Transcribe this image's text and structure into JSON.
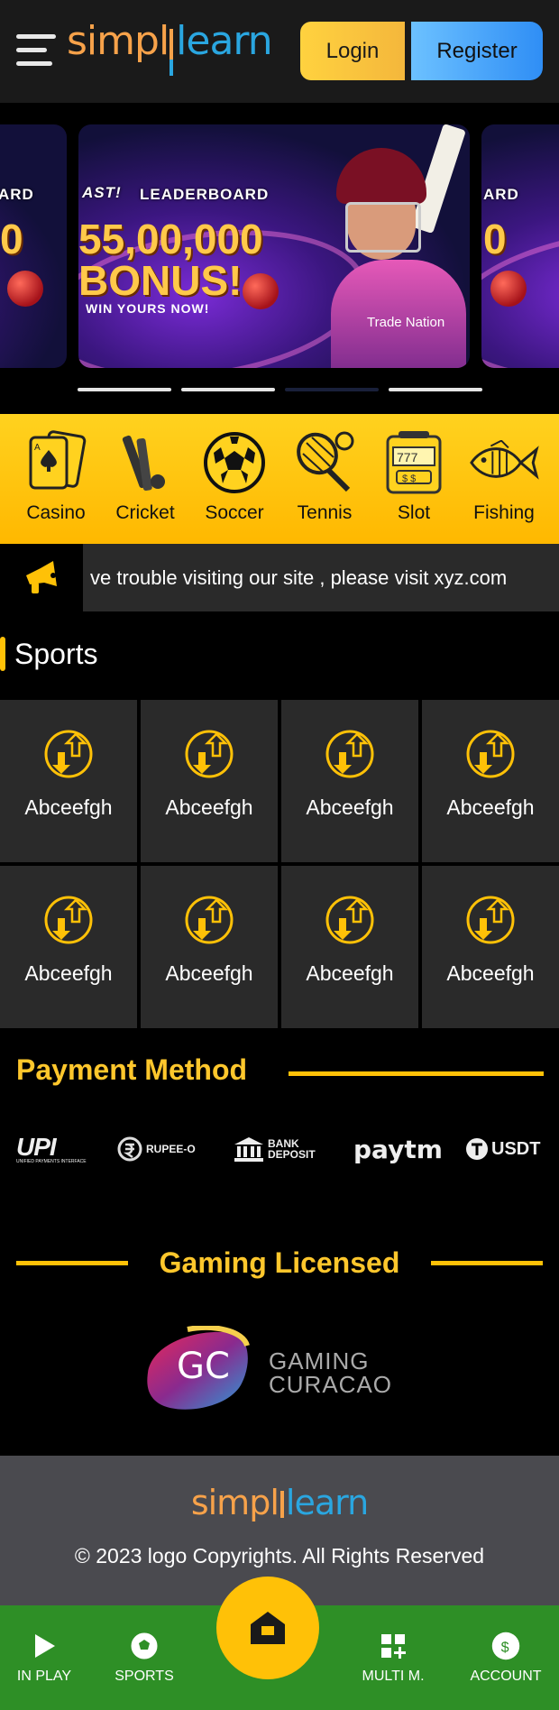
{
  "header": {
    "logo_left": "simpl",
    "logo_right": "learn",
    "login_label": "Login",
    "register_label": "Register"
  },
  "banner": {
    "leaderboard": "LEADERBOARD",
    "brand_tag": "AST!",
    "amount": "55,00,000",
    "bonus": "BONUS!",
    "win_text": "WIN YOURS NOW!",
    "sponsor": "Trade Nation",
    "side_left_top": "ARD",
    "side_left_amount": "0",
    "side_right_top": "ARD",
    "side_right_amount": "0",
    "slides_count": 4,
    "active_slide": 3
  },
  "categories": [
    {
      "label": "Casino",
      "icon": "cards-icon"
    },
    {
      "label": "Cricket",
      "icon": "cricket-icon"
    },
    {
      "label": "Soccer",
      "icon": "soccer-ball-icon"
    },
    {
      "label": "Tennis",
      "icon": "tennis-icon"
    },
    {
      "label": "Slot",
      "icon": "slot-machine-icon"
    },
    {
      "label": "Fishing",
      "icon": "fish-icon"
    }
  ],
  "marquee": {
    "text": "ve trouble visiting our site , please visit xyz.com"
  },
  "sports": {
    "title": "Sports",
    "items": [
      {
        "label": "Abceefgh"
      },
      {
        "label": "Abceefgh"
      },
      {
        "label": "Abceefgh"
      },
      {
        "label": "Abceefgh"
      },
      {
        "label": "Abceefgh"
      },
      {
        "label": "Abceefgh"
      },
      {
        "label": "Abceefgh"
      },
      {
        "label": "Abceefgh"
      }
    ]
  },
  "payment": {
    "title": "Payment Method",
    "methods": [
      "UPI",
      "RUPEE-O",
      "BANK DEPOSIT",
      "paytm",
      "USDT"
    ],
    "upi_sub": "UNIFIED PAYMENTS INTERFACE"
  },
  "license": {
    "title": "Gaming Licensed",
    "gc_mark": "GC",
    "gc_line1": "GAMING",
    "gc_line2": "CURACAO"
  },
  "footer": {
    "logo_left": "simpl",
    "logo_right": "learn",
    "copyright": "© 2023 logo Copyrights. All Rights Reserved"
  },
  "bottom_nav": {
    "in_play": "IN PLAY",
    "sports": "SPORTS",
    "multi": "MULTI M.",
    "account": "ACCOUNT"
  },
  "colors": {
    "accent_yellow": "#ffc107",
    "nav_green": "#2e8f26",
    "logo_orange": "#f7a24a",
    "logo_blue": "#2aa6e0"
  }
}
